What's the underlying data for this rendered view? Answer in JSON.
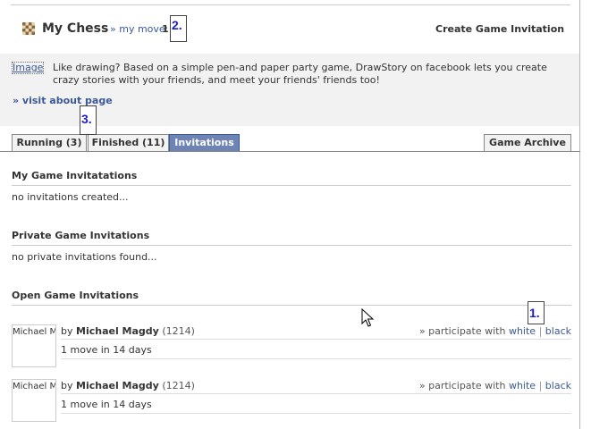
{
  "header": {
    "app_title": "My Chess",
    "my_move_label": "» my move:",
    "my_move_count": "1",
    "create_invitation": "Create Game Invitation"
  },
  "markers": {
    "m1": "1.",
    "m2": "2.",
    "m3": "3."
  },
  "promo": {
    "image_alt": "Image",
    "text": "Like drawing? Based on a simple pen-and paper party game, DrawStory on facebook lets you create crazy stories with your friends, and meet your friends' friends too!",
    "visit_link": "» visit about page"
  },
  "tabs": {
    "running": "Running (3)",
    "finished": "Finished (11)",
    "invitations": "Invitations",
    "archive": "Game Archive"
  },
  "sections": {
    "my": {
      "title": "My Game Invitatations",
      "empty": "no invitations created..."
    },
    "private": {
      "title": "Private Game Invitations",
      "empty": "no private invitations found..."
    },
    "open": {
      "title": "Open Game Invitations"
    }
  },
  "invitations": [
    {
      "avatar_alt": "Michael Magdy",
      "by": "by",
      "player": "Michael Magdy",
      "rating": "(1214)",
      "participate_prefix": "» participate with",
      "white": "white",
      "sep": "|",
      "black": "black",
      "moves": "1 move in 14 days"
    },
    {
      "avatar_alt": "Michael Magdy",
      "by": "by",
      "player": "Michael Magdy",
      "rating": "(1214)",
      "participate_prefix": "» participate with",
      "white": "white",
      "sep": "|",
      "black": "black",
      "moves": "1 move in 14 days"
    }
  ],
  "colors": {
    "link": "#3b5998",
    "active_tab": "#6d84b4",
    "promo_bg": "#f2f2f2",
    "marker_text": "#1c1cc8"
  },
  "icons": {
    "app": "chessboard-icon",
    "cursor": "mouse-pointer-icon"
  }
}
